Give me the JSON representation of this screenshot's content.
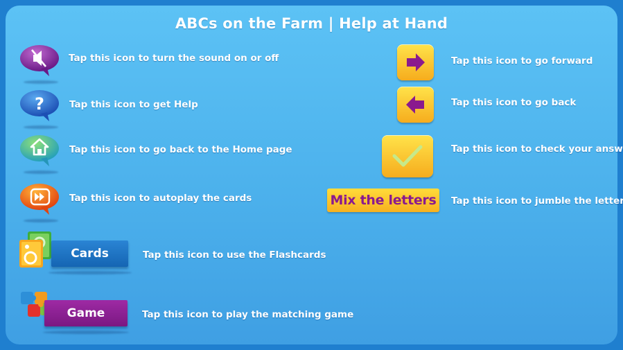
{
  "title": "ABCs on the Farm | Help at Hand",
  "left_items": [
    {
      "icon": "sound-off-icon",
      "text": "Tap this icon to turn the sound on or off"
    },
    {
      "icon": "help-icon",
      "glyph": "?",
      "text": "Tap this icon to get Help"
    },
    {
      "icon": "home-icon",
      "text": "Tap this icon to go back to the Home page"
    },
    {
      "icon": "autoplay-icon",
      "text": "Tap this icon to autoplay the cards"
    }
  ],
  "right_items": [
    {
      "icon": "arrow-forward-icon",
      "text": "Tap this icon to go forward"
    },
    {
      "icon": "arrow-back-icon",
      "text": "Tap this icon to go back"
    },
    {
      "icon": "check-answer-icon",
      "text": "Tap this icon to check your answer"
    },
    {
      "icon": "mix-letters-button",
      "label": "Mix the letters",
      "text": "Tap this icon to jumble the letters"
    }
  ],
  "buttons": {
    "cards": {
      "label": "Cards",
      "text": "Tap this icon to use the Flashcards",
      "color": "#1a6fc0"
    },
    "game": {
      "label": "Game",
      "text": "Tap this icon to play the matching game",
      "color": "#8c1f93"
    }
  },
  "colors": {
    "frame": "#1f7fcf",
    "panel": "#5cc2f5",
    "accent_purple": "#8a1a8e",
    "tile_yellow": "#ffd22e"
  }
}
